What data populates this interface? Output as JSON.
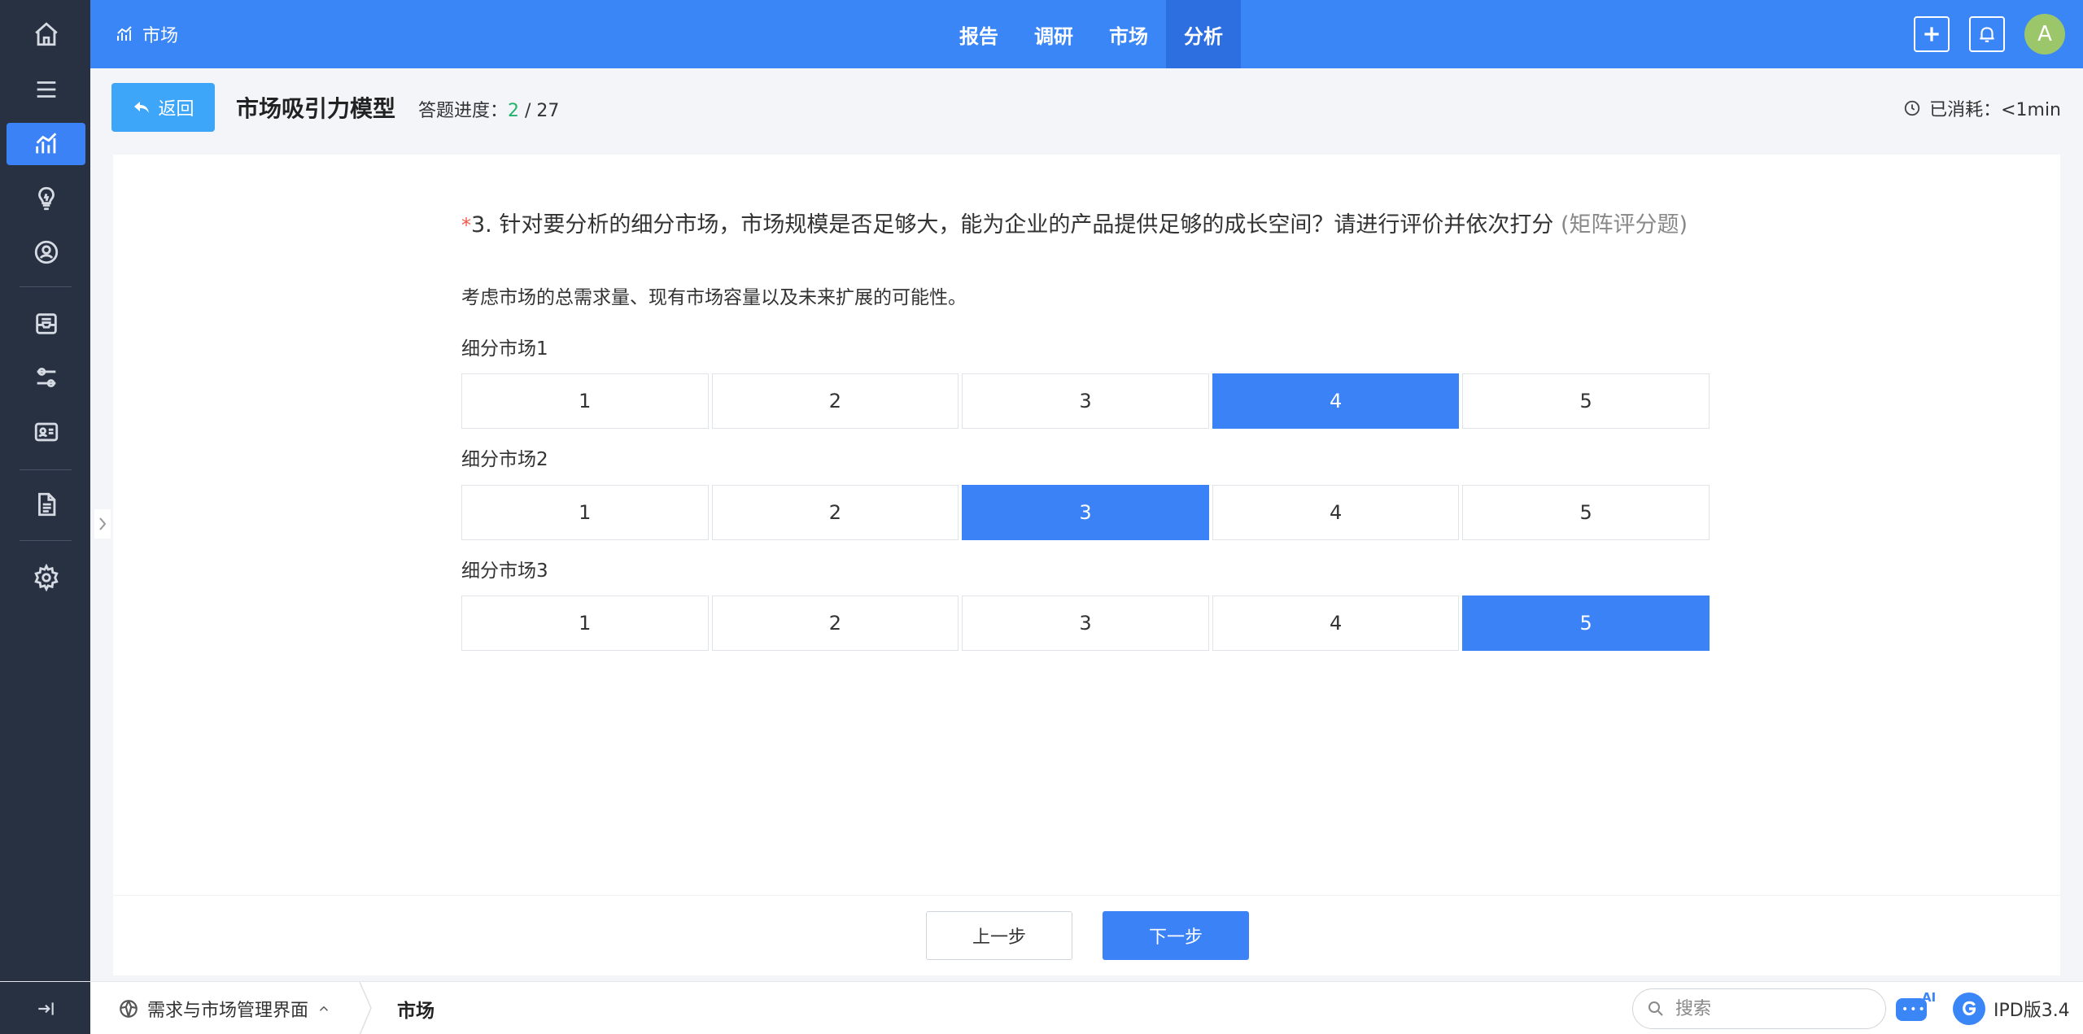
{
  "app": {
    "brand_label": "市场",
    "nav": [
      "报告",
      "调研",
      "市场",
      "分析"
    ],
    "nav_active": "分析"
  },
  "header": {
    "back_label": "返回",
    "title": "市场吸引力模型",
    "progress_label": "答题进度：",
    "progress_current": "2",
    "progress_total": "/ 27",
    "elapsed_label": "已消耗：<1min"
  },
  "question": {
    "required_mark": "*",
    "text": "3. 针对要分析的细分市场，市场规模是否足够大，能为企业的产品提供足够的成长空间？请进行评价并依次打分",
    "type_label": "(矩阵评分题)",
    "hint": "考虑市场的总需求量、现有市场容量以及未来扩展的可能性。",
    "rows": [
      {
        "label": "细分市场1",
        "options": [
          "1",
          "2",
          "3",
          "4",
          "5"
        ],
        "selected": "4"
      },
      {
        "label": "细分市场2",
        "options": [
          "1",
          "2",
          "3",
          "4",
          "5"
        ],
        "selected": "3"
      },
      {
        "label": "细分市场3",
        "options": [
          "1",
          "2",
          "3",
          "4",
          "5"
        ],
        "selected": "5"
      }
    ]
  },
  "footer": {
    "prev_label": "上一步",
    "next_label": "下一步"
  },
  "bottombar": {
    "module_label": "需求与市场管理界面",
    "current_tab": "市场",
    "search_placeholder": "搜索",
    "ai_badge": "AI",
    "version": "IPD版3.4"
  },
  "colors": {
    "accent": "#3b82f6",
    "topbar": "#3b86f7",
    "sidebar": "#283142",
    "progress_current": "#22b26e",
    "required": "#f05a4a"
  },
  "icons": {
    "sidebar": [
      "home-icon",
      "menu-icon",
      "chart-icon",
      "lightbulb-icon",
      "user-circle-icon",
      "inbox-icon",
      "sliders-icon",
      "id-card-icon",
      "document-icon",
      "gear-icon"
    ]
  }
}
